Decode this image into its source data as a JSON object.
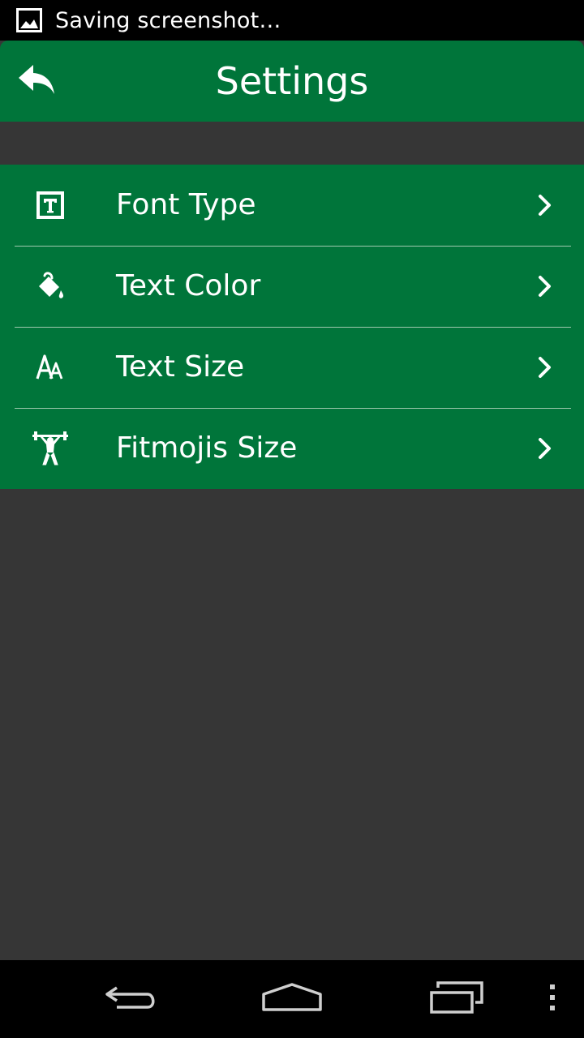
{
  "status_bar": {
    "notification_icon": "image-icon",
    "text": "Saving screenshot…"
  },
  "app_bar": {
    "title": "Settings",
    "back_icon": "reply-arrow-icon"
  },
  "settings": {
    "items": [
      {
        "label": "Font Type",
        "icon": "font-type-icon"
      },
      {
        "label": "Text Color",
        "icon": "paint-bucket-icon"
      },
      {
        "label": "Text Size",
        "icon": "text-size-icon"
      },
      {
        "label": "Fitmojis Size",
        "icon": "weightlifter-icon"
      }
    ],
    "chevron_icon": "chevron-right-icon"
  },
  "nav_bar": {
    "buttons": [
      "back-icon",
      "home-icon",
      "recent-apps-icon",
      "overflow-menu-icon"
    ]
  },
  "colors": {
    "accent": "#00753a",
    "background": "#363636",
    "bars": "#000000",
    "text": "#ffffff"
  }
}
